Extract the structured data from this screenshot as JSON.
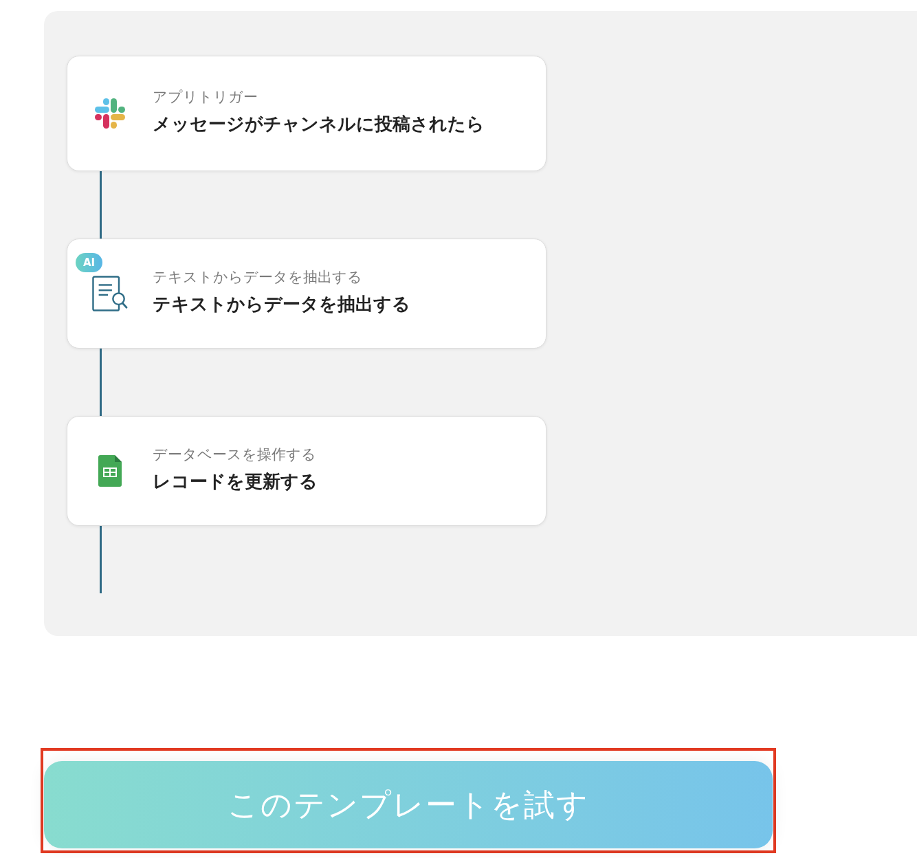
{
  "flow": {
    "steps": [
      {
        "kind": "trigger",
        "label": "アプリトリガー",
        "title": "メッセージがチャンネルに投稿されたら"
      },
      {
        "kind": "extract",
        "badge": "AI",
        "label": "テキストからデータを抽出する",
        "title": "テキストからデータを抽出する"
      },
      {
        "kind": "sheet",
        "label": "データベースを操作する",
        "title": "レコードを更新する"
      }
    ]
  },
  "cta": {
    "label": "このテンプレートを試す",
    "highlighted": true
  }
}
